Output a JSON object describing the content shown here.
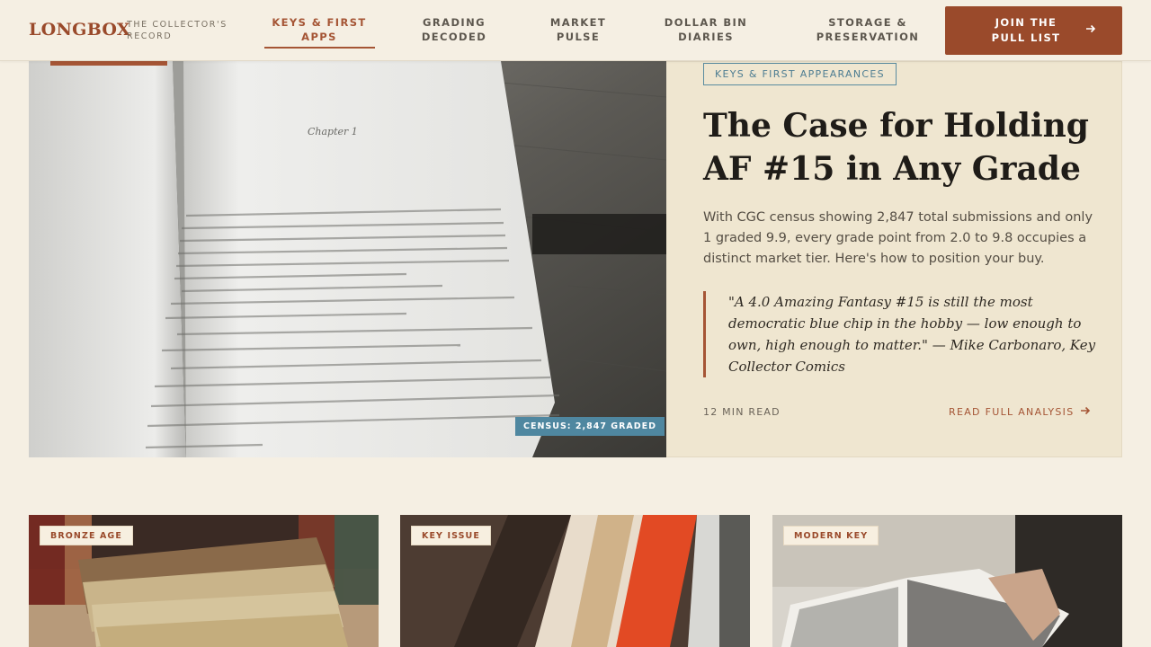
{
  "brand": {
    "logo": "LONGBOX",
    "tagline": "THE COLLECTOR'S RECORD"
  },
  "nav": {
    "items": [
      {
        "label": "KEYS & FIRST APPS",
        "active": true
      },
      {
        "label": "GRADING DECODED",
        "active": false
      },
      {
        "label": "MARKET PULSE",
        "active": false
      },
      {
        "label": "DOLLAR BIN DIARIES",
        "active": false
      },
      {
        "label": "STORAGE & PRESERVATION",
        "active": false
      }
    ],
    "cta_label": "JOIN THE PULL LIST",
    "cta_icon": "arrow-right-icon"
  },
  "hero": {
    "image_label": "open book photo",
    "census_badge": "CENSUS: 2,847 GRADED",
    "tag": "KEYS & FIRST APPEARANCES",
    "title": "The Case for Holding AF #15 in Any Grade",
    "description": "With CGC census showing 2,847 total submissions and only 1 graded 9.9, every grade point from 2.0 to 9.8 occupies a distinct market tier. Here's how to position your buy.",
    "quote": "\"A 4.0 Amazing Fantasy #15 is still the most democratic blue chip in the hobby — low enough to own, high enough to matter.\" — Mike Carbonaro, Key Collector Comics",
    "read_time": "12 MIN READ",
    "read_link": "READ FULL ANALYSIS"
  },
  "cards": [
    {
      "badge": "BRONZE AGE"
    },
    {
      "badge": "KEY ISSUE"
    },
    {
      "badge": "MODERN KEY"
    }
  ],
  "colors": {
    "accent": "#9a4a2b",
    "teal": "#4f87a0",
    "background": "#f5efe3",
    "panel": "#efe6d0"
  }
}
